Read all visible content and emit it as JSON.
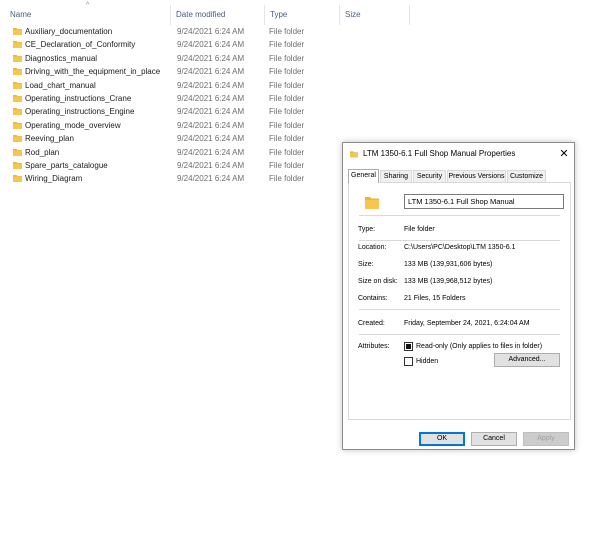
{
  "columns": {
    "name": "Name",
    "date_modified": "Date modified",
    "type": "Type",
    "size": "Size"
  },
  "sort_indicator": "^",
  "rows": [
    {
      "name": "Auxiliary_documentation",
      "date": "9/24/2021 6:24 AM",
      "type": "File folder"
    },
    {
      "name": "CE_Declaration_of_Conformity",
      "date": "9/24/2021 6:24 AM",
      "type": "File folder"
    },
    {
      "name": "Diagnostics_manual",
      "date": "9/24/2021 6:24 AM",
      "type": "File folder"
    },
    {
      "name": "Driving_with_the_equipment_in_place",
      "date": "9/24/2021 6:24 AM",
      "type": "File folder"
    },
    {
      "name": "Load_chart_manual",
      "date": "9/24/2021 6:24 AM",
      "type": "File folder"
    },
    {
      "name": "Operating_instructions_Crane",
      "date": "9/24/2021 6:24 AM",
      "type": "File folder"
    },
    {
      "name": "Operating_instructions_Engine",
      "date": "9/24/2021 6:24 AM",
      "type": "File folder"
    },
    {
      "name": "Operating_mode_overview",
      "date": "9/24/2021 6:24 AM",
      "type": "File folder"
    },
    {
      "name": "Reeving_plan",
      "date": "9/24/2021 6:24 AM",
      "type": "File folder"
    },
    {
      "name": "Rod_plan",
      "date": "9/24/2021 6:24 AM",
      "type": "File folder"
    },
    {
      "name": "Spare_parts_catalogue",
      "date": "9/24/2021 6:24 AM",
      "type": "File folder"
    },
    {
      "name": "Wiring_Diagram",
      "date": "9/24/2021 6:24 AM",
      "type": "File folder"
    }
  ],
  "dialog": {
    "title": "LTM 1350-6.1 Full Shop Manual Properties",
    "close_glyph": "✕",
    "tabs": [
      "General",
      "Sharing",
      "Security",
      "Previous Versions",
      "Customize"
    ],
    "folder_name": "LTM 1350-6.1 Full Shop Manual",
    "fields": {
      "type_label": "Type:",
      "type_value": "File folder",
      "location_label": "Location:",
      "location_value": "C:\\Users\\PC\\Desktop\\LTM 1350-6.1",
      "size_label": "Size:",
      "size_value": "133 MB (139,931,606 bytes)",
      "size_on_disk_label": "Size on disk:",
      "size_on_disk_value": "133 MB (139,968,512 bytes)",
      "contains_label": "Contains:",
      "contains_value": "21 Files, 15 Folders",
      "created_label": "Created:",
      "created_value": "Friday, September 24, 2021, 6:24:04 AM",
      "attributes_label": "Attributes:"
    },
    "readonly_label": "Read-only (Only applies to files in folder)",
    "hidden_label": "Hidden",
    "advanced_label": "Advanced...",
    "ok_label": "OK",
    "cancel_label": "Cancel",
    "apply_label": "Apply"
  },
  "colors": {
    "folder": "#e8b53d",
    "folder_dark": "#d9a12a",
    "accent": "#0078d7"
  }
}
